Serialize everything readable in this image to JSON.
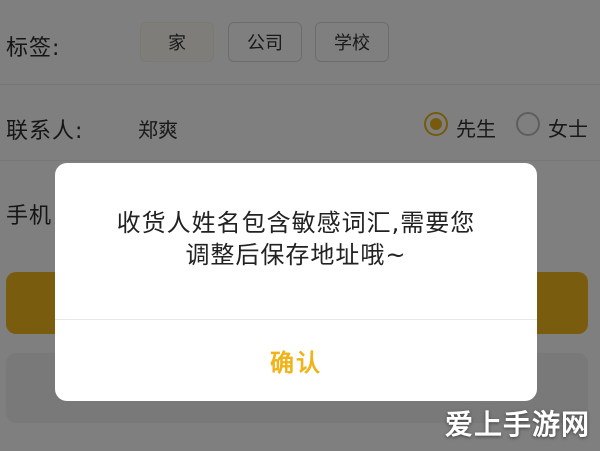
{
  "form": {
    "tag_label": "标签:",
    "tags": [
      "家",
      "公司",
      "学校"
    ],
    "contact_label": "联系人:",
    "contact_name": "郑爽",
    "gender_options": [
      "先生",
      "女士"
    ],
    "gender_selected": "先生",
    "phone_label": "手机"
  },
  "dialog": {
    "message_line1": "收货人姓名包含敏感词汇,需要您",
    "message_line2": "调整后保存地址哦~",
    "confirm_label": "确认"
  },
  "watermark": {
    "text": "爱上手游网"
  },
  "colors": {
    "accent": "#f0b41a",
    "save_bar": "#f4b81e",
    "overlay": "rgba(0,0,0,0.5)"
  }
}
